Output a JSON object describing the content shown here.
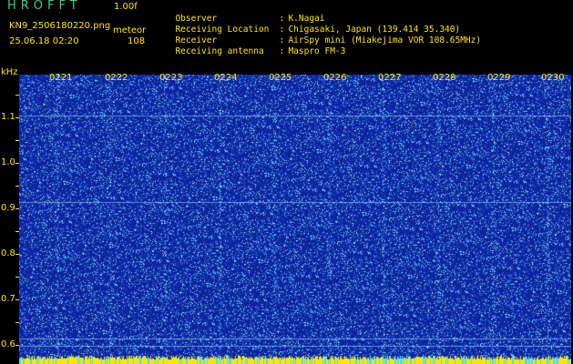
{
  "app": {
    "title": "HROFFT",
    "version": "1.00f"
  },
  "file": {
    "name": "KN9_2506180220.png",
    "datetime": "25.06.18 02:20"
  },
  "meteor": {
    "label": "meteor",
    "count": "108"
  },
  "info": [
    {
      "label": "Observer",
      "sep": ":",
      "value": "K.Nagai"
    },
    {
      "label": "Receiving Location",
      "sep": ":",
      "value": "Chigasaki, Japan (139.414 35.340)"
    },
    {
      "label": "Receiver",
      "sep": ":",
      "value": "AirSpy mini (Miakejima VOR 108.65MHz)"
    },
    {
      "label": "Receiving antenna",
      "sep": ":",
      "value": "Maspro FM-3"
    }
  ],
  "spectrogram": {
    "unit": "kHz",
    "time_labels": [
      "0221",
      "0222",
      "0223",
      "0224",
      "0225",
      "0226",
      "0227",
      "0228",
      "0229",
      "0230"
    ],
    "freq_labels": [
      "1.1",
      "1.0",
      "0.9",
      "0.8",
      "0.7",
      "0.6"
    ],
    "freq_range_khz": [
      0.55,
      1.15
    ],
    "colors": {
      "background": "#0a1aa0",
      "noise": "#3fb8e8",
      "label": "#ffe600",
      "carrier_line": "#9fe8ff",
      "bottom_band": "#ffe600"
    }
  }
}
